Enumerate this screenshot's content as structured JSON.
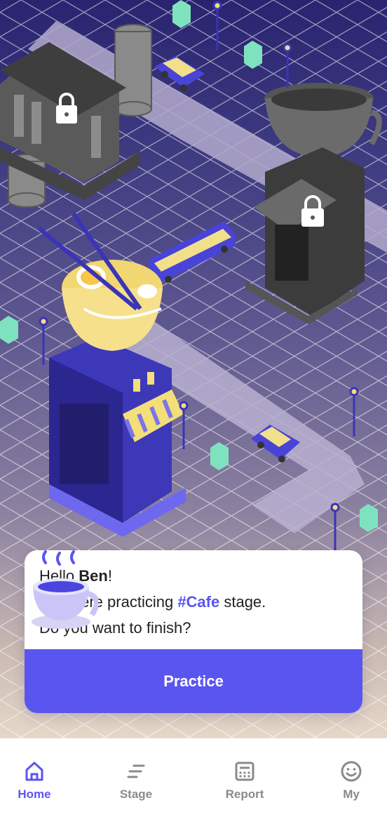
{
  "greeting": {
    "hello": "Hello ",
    "name": "Ben",
    "exclaim": "!",
    "line2_prefix": "You were practicing ",
    "stage_tag": "#Cafe",
    "line2_suffix": " stage.",
    "line3": "Do you want to finish?"
  },
  "practice_button": "Practice",
  "nav": [
    {
      "label": "Home",
      "icon": "home-icon",
      "active": true
    },
    {
      "label": "Stage",
      "icon": "stage-icon",
      "active": false
    },
    {
      "label": "Report",
      "icon": "calculator-icon",
      "active": false
    },
    {
      "label": "My",
      "icon": "smiley-icon",
      "active": false
    }
  ],
  "colors": {
    "accent": "#5b55f0",
    "inactive": "#8a8a8a"
  }
}
